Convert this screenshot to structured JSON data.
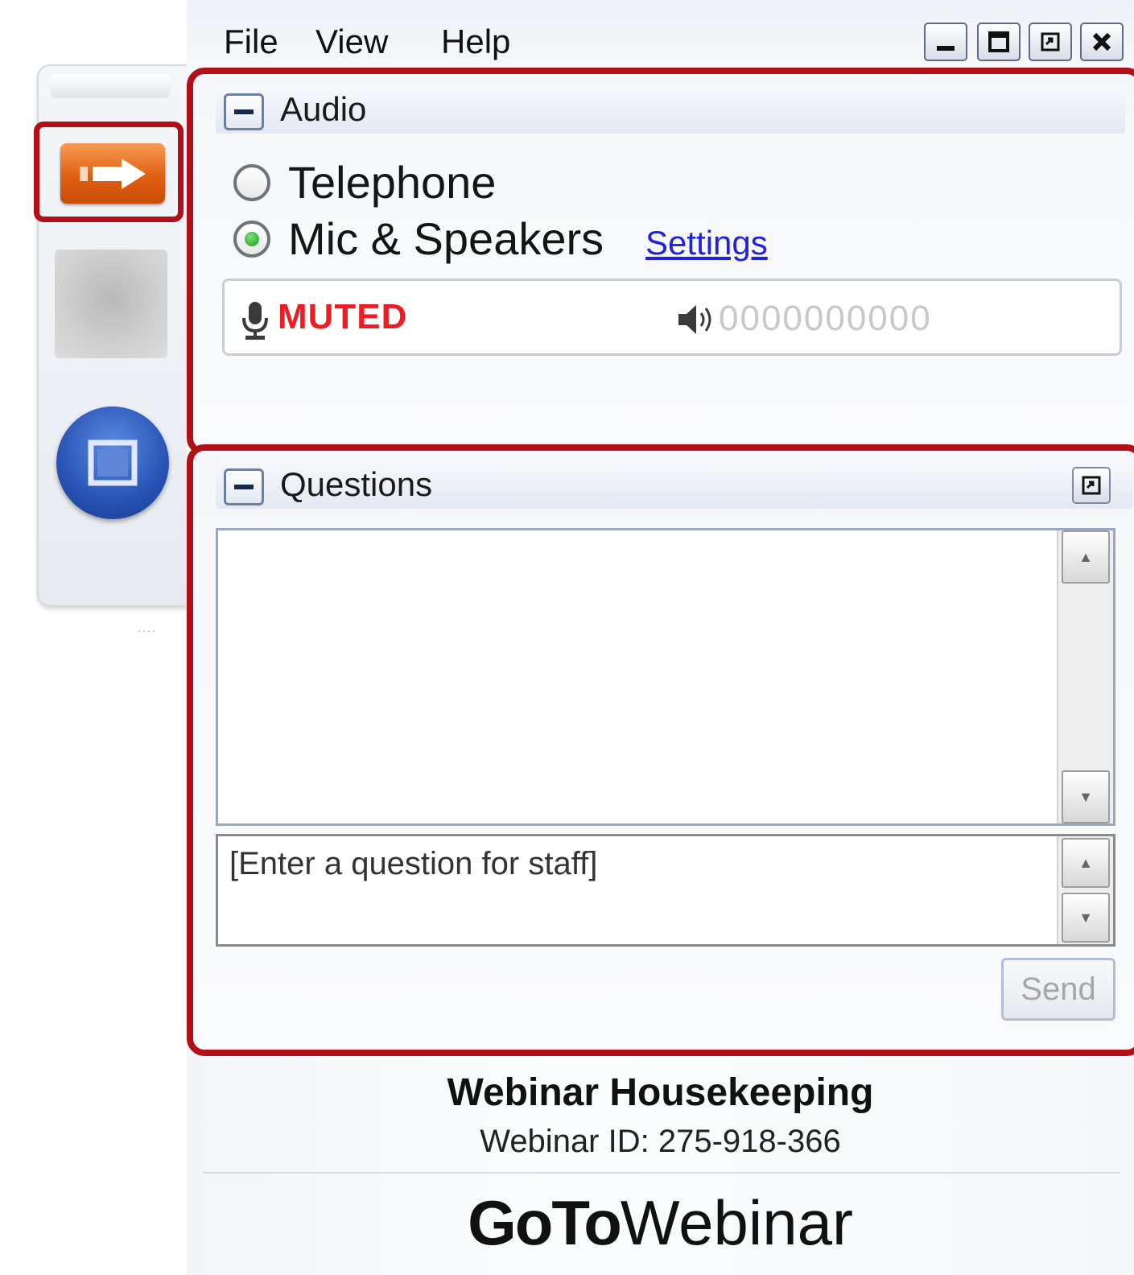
{
  "menu": {
    "file": "File",
    "view": "View",
    "help": "Help"
  },
  "audio": {
    "title": "Audio",
    "option_telephone": "Telephone",
    "option_mic": "Mic & Speakers",
    "settings_link": "Settings",
    "selected": "Mic & Speakers",
    "status": "MUTED",
    "level_meter": "0000000000"
  },
  "questions": {
    "title": "Questions",
    "input_placeholder": "[Enter a question for staff]",
    "send_label": "Send"
  },
  "footer": {
    "title": "Webinar Housekeeping",
    "webinar_id": "Webinar ID: 275-918-366",
    "brand_bold": "GoTo",
    "brand_light": "Webinar"
  },
  "colors": {
    "highlight_border": "#b30f17",
    "muted_red": "#ee1d24",
    "link_blue": "#2222dd",
    "accent_orange": "#e06012",
    "accent_blue": "#2853b5"
  },
  "icons": [
    "arrow-right-icon",
    "screen-share-icon",
    "microphone-icon",
    "speaker-icon",
    "minimize-icon",
    "maximize-icon",
    "restore-icon",
    "close-icon",
    "popout-icon",
    "scroll-up-icon",
    "scroll-down-icon"
  ]
}
